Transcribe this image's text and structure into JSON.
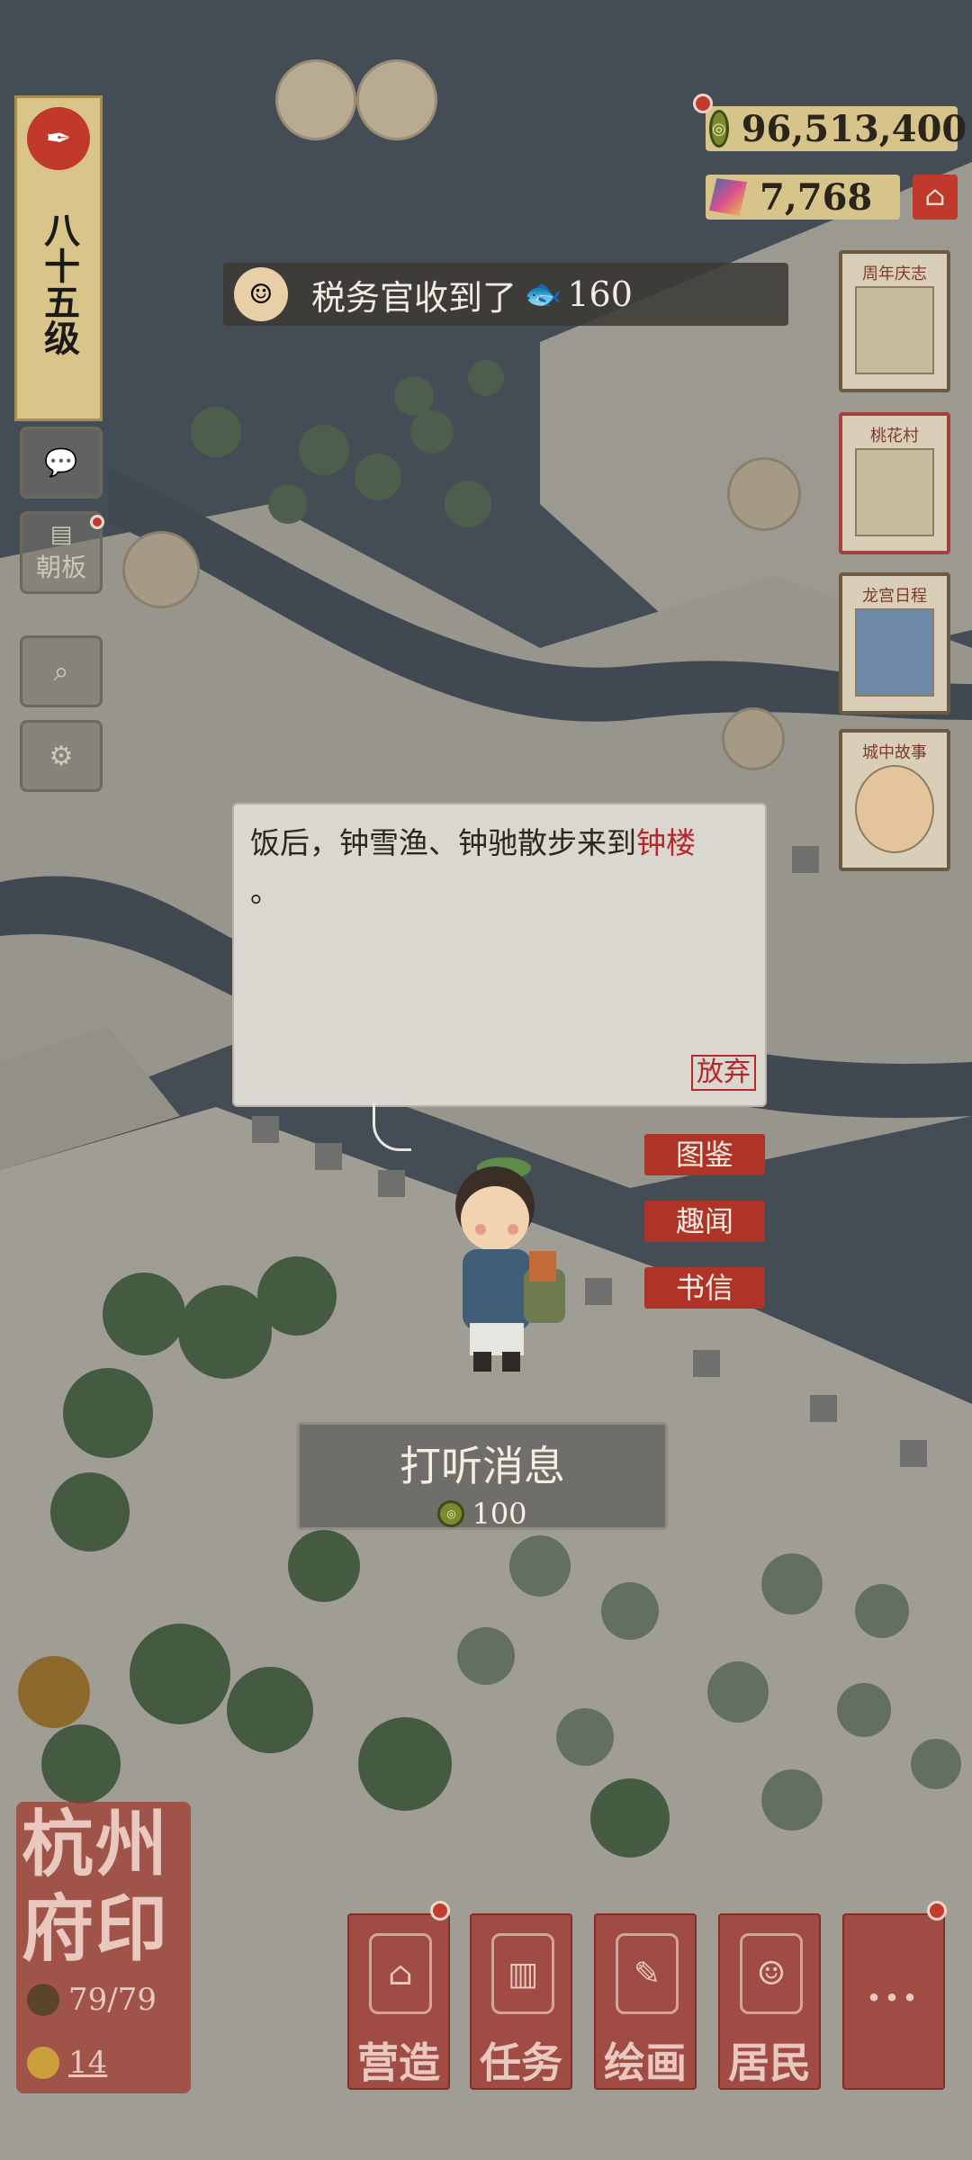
{
  "player": {
    "level_label": "八十五级"
  },
  "currency": {
    "coins": "96,513,400",
    "gems": "7,768"
  },
  "toast": {
    "text": "税务官收到了",
    "amount": "160"
  },
  "left_menu": {
    "board_label": "朝板"
  },
  "right_cards": [
    {
      "label": "周年庆志"
    },
    {
      "label": "桃花村"
    },
    {
      "label": "龙宫日程"
    },
    {
      "label": "城中故事"
    }
  ],
  "dialog": {
    "text_part1": "饭后，钟雪渔、钟驰散步来到",
    "text_highlight": "钟楼",
    "text_part2": "。",
    "abandon_label": "放弃"
  },
  "side_actions": [
    {
      "label": "图鉴"
    },
    {
      "label": "趣闻"
    },
    {
      "label": "书信"
    }
  ],
  "inquire": {
    "label": "打听消息",
    "cost": "100"
  },
  "city_seal": {
    "title": "杭州府印",
    "residents": "79/79",
    "count": "14"
  },
  "bottom_menu": [
    {
      "label": "营造"
    },
    {
      "label": "任务"
    },
    {
      "label": "绘画"
    },
    {
      "label": "居民"
    },
    {
      "label": "..."
    }
  ],
  "colors": {
    "accent_red": "#b03328",
    "gold": "#d6c48a",
    "water": "#4f5a66"
  }
}
